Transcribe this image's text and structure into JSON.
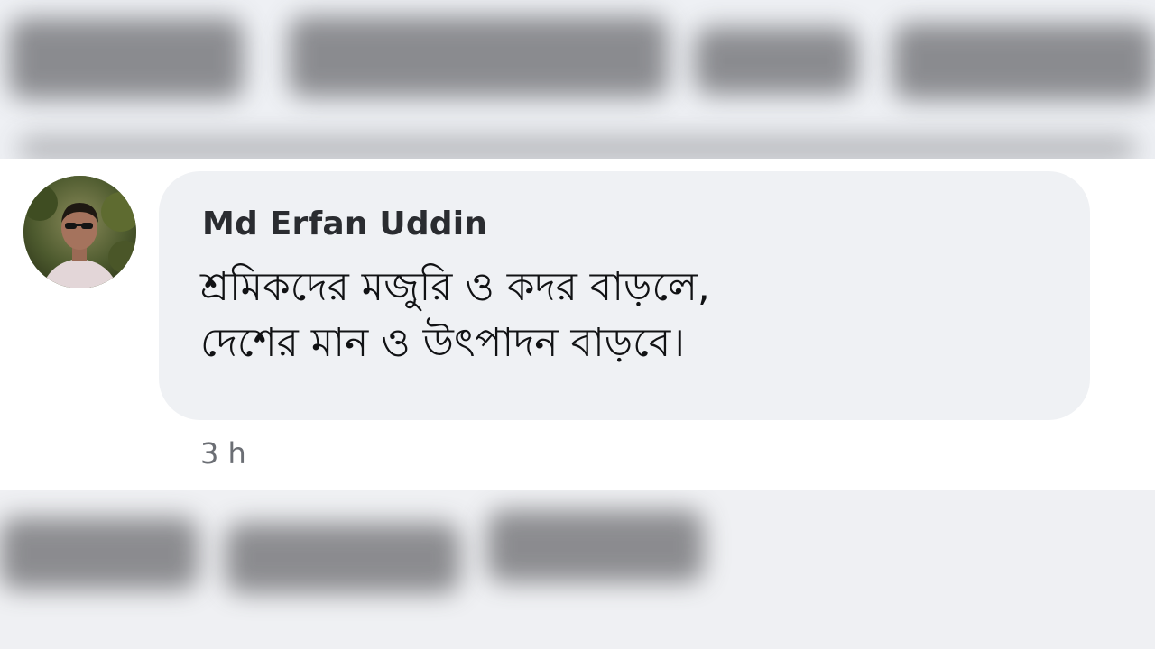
{
  "comment": {
    "author": "Md Erfan Uddin",
    "text_line_1": "শ্রমিকদের মজুরি ও কদর বাড়লে,",
    "text_line_2": "দেশের মান ও উৎপাদন বাড়বে।",
    "timestamp": "3 h"
  },
  "avatar": {
    "icon": "profile-photo"
  }
}
